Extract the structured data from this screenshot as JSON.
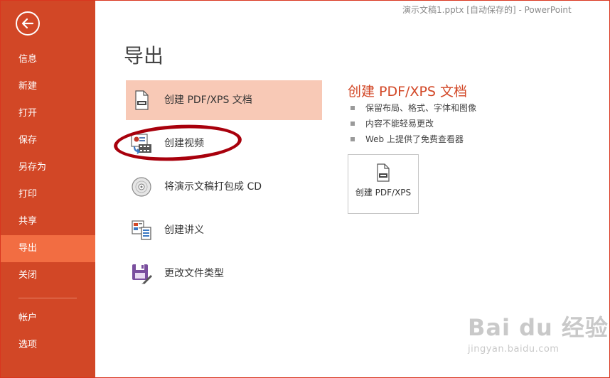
{
  "window": {
    "title": "演示文稿1.pptx [自动保存的] - PowerPoint"
  },
  "sidebar": {
    "back_icon": "back-arrow-icon",
    "items": [
      {
        "label": "信息"
      },
      {
        "label": "新建"
      },
      {
        "label": "打开"
      },
      {
        "label": "保存"
      },
      {
        "label": "另存为"
      },
      {
        "label": "打印"
      },
      {
        "label": "共享"
      },
      {
        "label": "导出",
        "active": true
      },
      {
        "label": "关闭"
      },
      {
        "label": "帐户"
      },
      {
        "label": "选项"
      }
    ]
  },
  "main": {
    "title": "导出",
    "options": [
      {
        "label": "创建 PDF/XPS 文档",
        "icon": "pdf-document-icon",
        "selected": true
      },
      {
        "label": "创建视频",
        "icon": "video-icon"
      },
      {
        "label": "将演示文稿打包成 CD",
        "icon": "cd-icon"
      },
      {
        "label": "创建讲义",
        "icon": "handout-icon"
      },
      {
        "label": "更改文件类型",
        "icon": "save-file-type-icon"
      }
    ]
  },
  "detail": {
    "title": "创建 PDF/XPS 文档",
    "bullets": [
      "保留布局、格式、字体和图像",
      "内容不能轻易更改",
      "Web 上提供了免费查看器"
    ],
    "button_label": "创建 PDF/XPS"
  },
  "watermark": {
    "main": "Bai du 经验",
    "sub": "jingyan.baidu.com"
  },
  "colors": {
    "sidebar": "#d24726",
    "sidebar_active": "#f26d42",
    "selected_option": "#f8c9b6",
    "accent_title": "#d24726",
    "annotation": "#a8000c"
  }
}
